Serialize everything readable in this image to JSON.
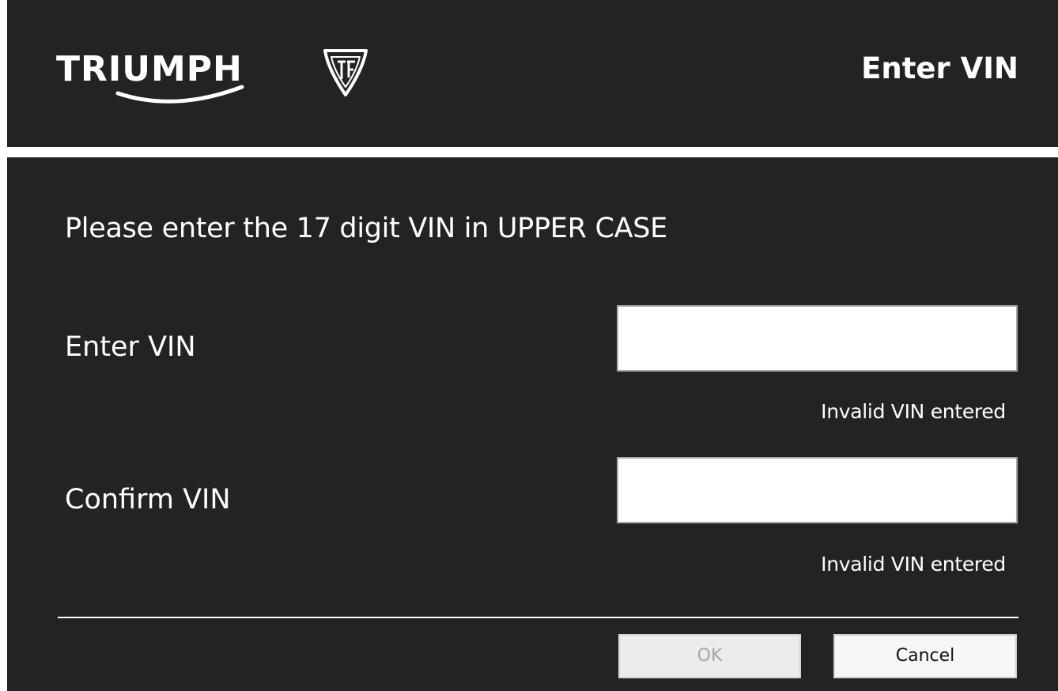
{
  "header": {
    "brand_text": "TRIUMPH",
    "title": "Enter VIN"
  },
  "main": {
    "instruction": "Please enter the 17 digit VIN in UPPER CASE",
    "fields": [
      {
        "label": "Enter VIN",
        "value": "",
        "error": "Invalid VIN entered"
      },
      {
        "label": "Confirm VIN",
        "value": "",
        "error": "Invalid VIN entered"
      }
    ]
  },
  "footer": {
    "ok_label": "OK",
    "ok_enabled": false,
    "cancel_label": "Cancel"
  },
  "icons": {
    "logo": "triumph-logo-icon"
  },
  "colors": {
    "background": "#252223",
    "text": "#ffffff",
    "disabled_text": "#a5a5a5"
  }
}
